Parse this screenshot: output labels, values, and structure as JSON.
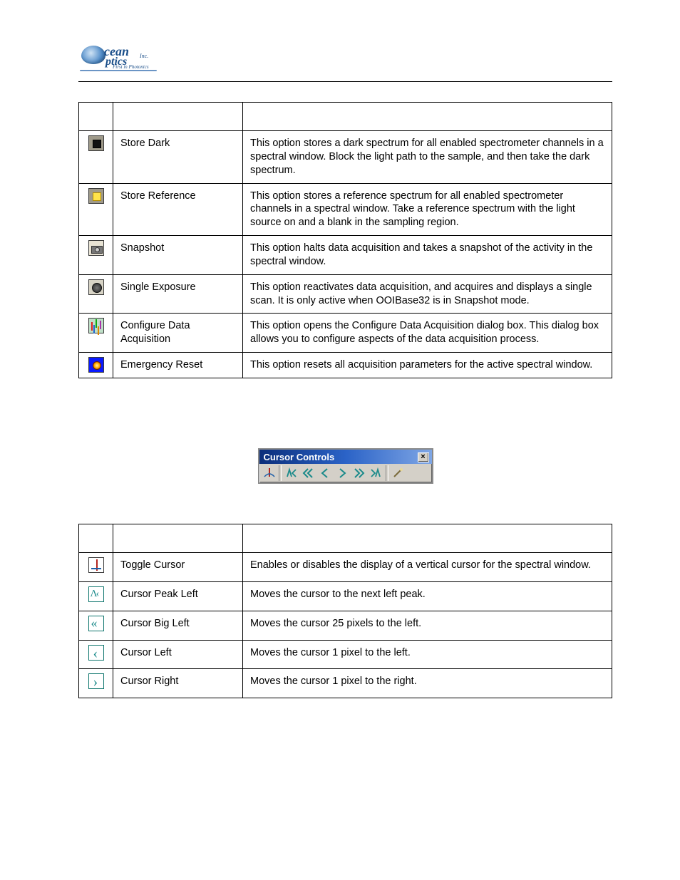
{
  "logo": {
    "brand_top": "cean",
    "brand_bottom": "ptics",
    "inc": "Inc.",
    "tagline": "First in Photonics"
  },
  "acq_table": {
    "rows": [
      {
        "icon": "store-dark-icon",
        "name": "Store Dark",
        "desc": "This option stores a dark spectrum for all enabled spectrometer channels in a spectral window. Block the light path to the sample, and then take the dark spectrum."
      },
      {
        "icon": "store-reference-icon",
        "name": "Store Reference",
        "desc": "This option stores a reference spectrum for all enabled spectrometer channels in a spectral window. Take a reference spectrum with the light source on and a blank in the sampling region."
      },
      {
        "icon": "snapshot-icon",
        "name": "Snapshot",
        "desc": "This option halts data acquisition and takes a snapshot of the activity in the spectral window."
      },
      {
        "icon": "single-exposure-icon",
        "name": "Single Exposure",
        "desc": "This option reactivates data acquisition, and acquires and displays a single scan. It is only active when OOIBase32 is in Snapshot mode."
      },
      {
        "icon": "configure-data-acq-icon",
        "name": "Configure Data Acquisition",
        "desc": "This option opens the Configure Data Acquisition dialog box. This dialog box allows you to configure aspects of the data acquisition process."
      },
      {
        "icon": "emergency-reset-icon",
        "name": "Emergency Reset",
        "desc": "This option resets all acquisition parameters for the active spectral window."
      }
    ]
  },
  "cursor_toolbar": {
    "title": "Cursor Controls",
    "buttons": [
      "toggle-cursor",
      "sep",
      "peak-left",
      "big-left",
      "left",
      "right",
      "big-right",
      "peak-right",
      "sep",
      "config"
    ]
  },
  "cursor_table": {
    "rows": [
      {
        "icon": "toggle-cursor-icon",
        "name": "Toggle Cursor",
        "desc": "Enables or disables the display of a vertical cursor for the spectral window."
      },
      {
        "icon": "cursor-peak-left-icon",
        "name": "Cursor Peak Left",
        "desc": "Moves the cursor to the next left peak."
      },
      {
        "icon": "cursor-big-left-icon",
        "name": "Cursor Big Left",
        "desc": "Moves the cursor 25 pixels to the left."
      },
      {
        "icon": "cursor-left-icon",
        "name": "Cursor Left",
        "desc": "Moves the cursor 1 pixel to the left."
      },
      {
        "icon": "cursor-right-icon",
        "name": "Cursor Right",
        "desc": "Moves the cursor 1 pixel to the right."
      }
    ]
  }
}
